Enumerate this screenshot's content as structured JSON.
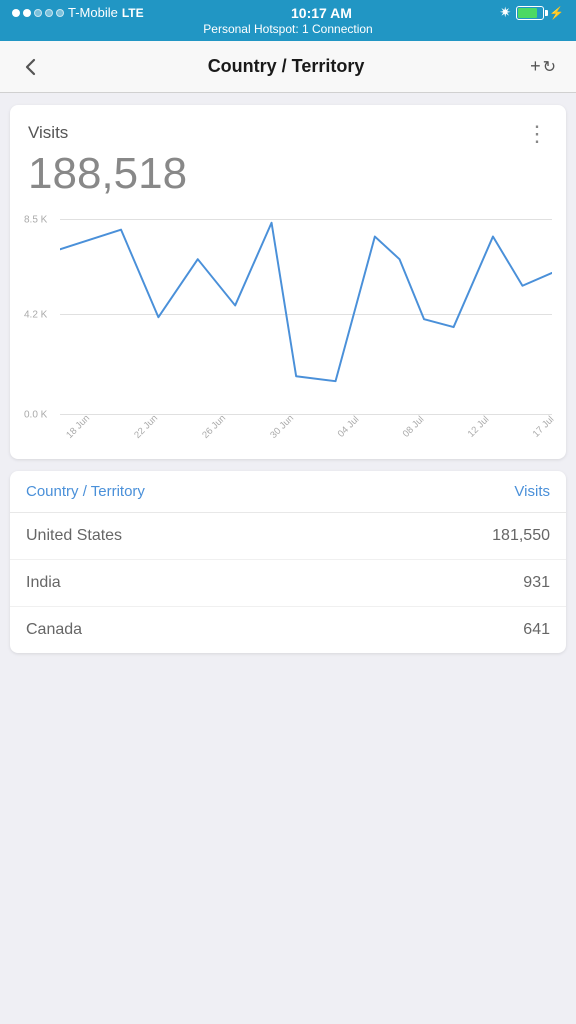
{
  "statusBar": {
    "carrier": "T-Mobile",
    "network": "LTE",
    "time": "10:17 AM",
    "hotspot": "Personal Hotspot: 1 Connection"
  },
  "navBar": {
    "title": "Country / Territory",
    "backLabel": "←",
    "actionLabel": "+↺"
  },
  "chart": {
    "label": "Visits",
    "value": "188,518",
    "gridLabels": [
      "8.5 K",
      "4.2 K",
      "0.0 K"
    ],
    "xLabels": [
      "18 Jun",
      "22 Jun",
      "26 Jun",
      "30 Jun",
      "04 Jul",
      "08 Jul",
      "12 Jul",
      "17 Jul"
    ],
    "moreIcon": "⋮"
  },
  "table": {
    "columns": [
      "Country / Territory",
      "Visits"
    ],
    "rows": [
      {
        "country": "United States",
        "visits": "181,550"
      },
      {
        "country": "India",
        "visits": "931"
      },
      {
        "country": "Canada",
        "visits": "641"
      }
    ]
  }
}
